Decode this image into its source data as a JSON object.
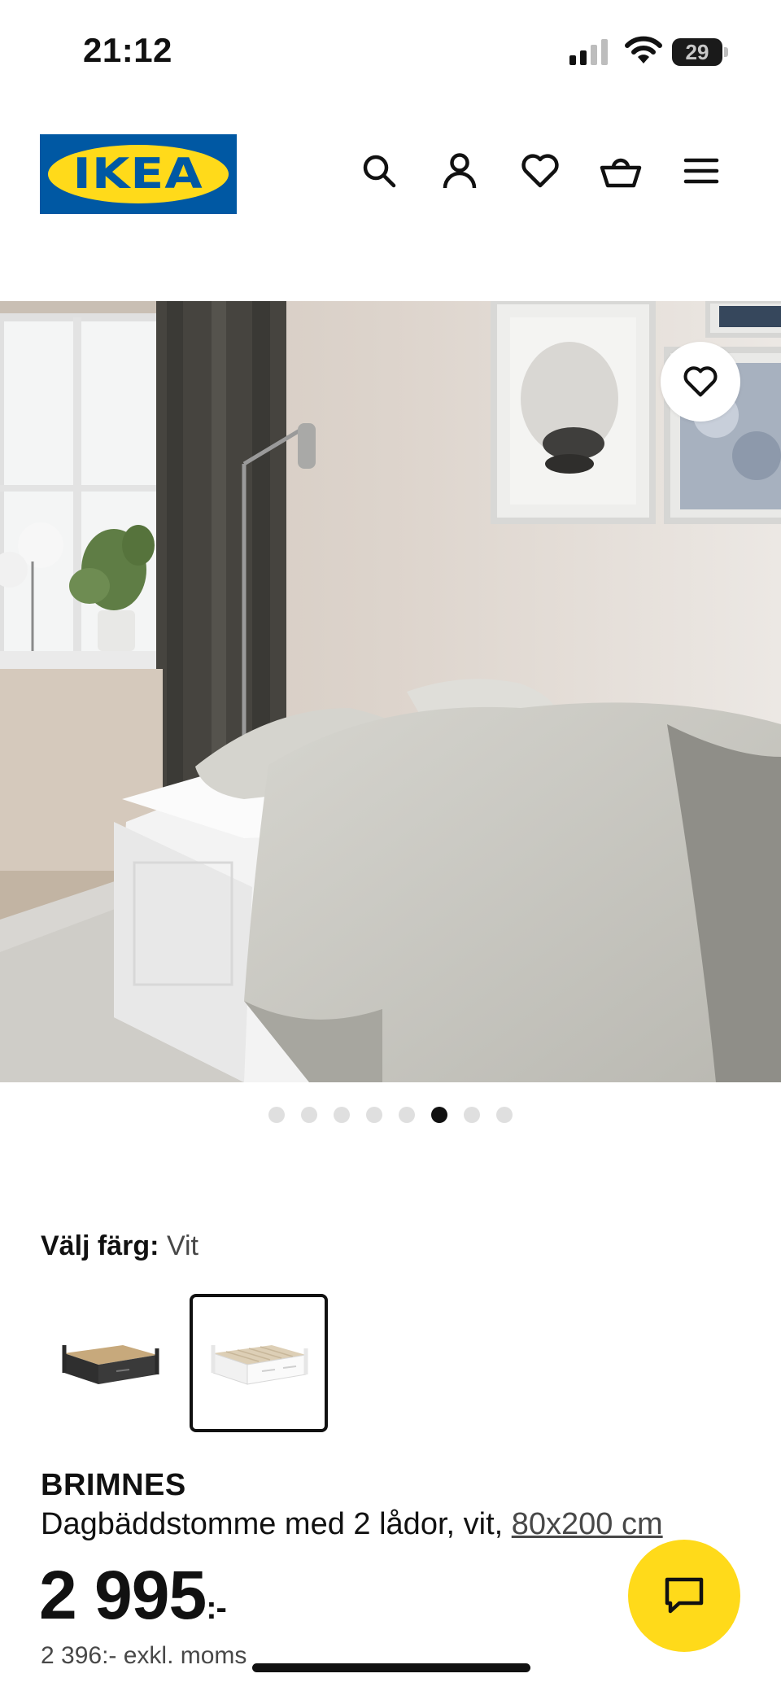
{
  "status_bar": {
    "time": "21:12",
    "battery_percent": "29"
  },
  "header": {
    "logo_text": "IKEA",
    "icons": [
      "search-icon",
      "account-icon",
      "heart-icon",
      "basket-icon",
      "menu-icon"
    ]
  },
  "gallery": {
    "total_images": 8,
    "active_index": 5,
    "favorite_icon": "heart-icon"
  },
  "color_select": {
    "label": "Välj färg:",
    "selected_value": "Vit",
    "options": [
      {
        "name": "black-brown",
        "selected": false
      },
      {
        "name": "white",
        "selected": true
      }
    ]
  },
  "product": {
    "name": "BRIMNES",
    "description": "Dagbäddstomme med 2 lådor, vit,",
    "size_link": "80x200 cm",
    "price": "2 995",
    "price_suffix": ":-",
    "price_ex_vat": "2 396:- exkl. moms"
  },
  "colors": {
    "ikea_blue": "#0058a3",
    "ikea_yellow": "#ffda1a",
    "text": "#111111"
  }
}
